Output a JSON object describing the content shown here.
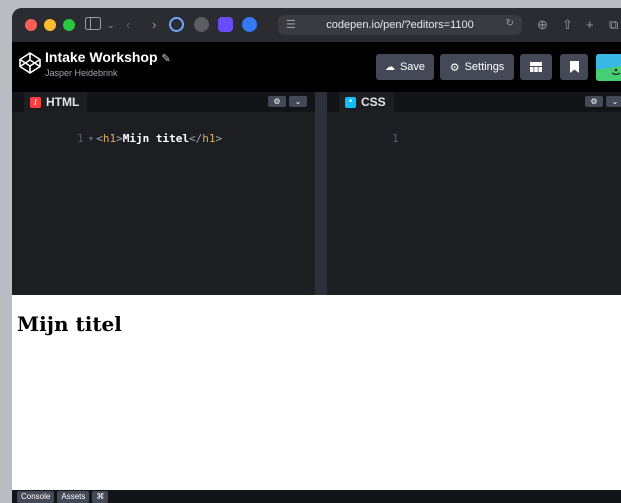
{
  "browser": {
    "url": "codepen.io/pen/?editors=1100",
    "traffic_colors": [
      "#ff5f57",
      "#febc2e",
      "#28c840"
    ],
    "icons": [
      "sidebar-icon",
      "chevron-down-icon",
      "back-icon",
      "forward-icon",
      "extension-icon",
      "extension-icon",
      "extension-icon",
      "extension-icon",
      "download-icon",
      "share-icon",
      "new-tab-icon",
      "tabs-icon"
    ]
  },
  "pen": {
    "title": "Intake Workshop",
    "author": "Jasper Heidebrink"
  },
  "header": {
    "save_label": "Save",
    "settings_label": "Settings"
  },
  "editors": {
    "html": {
      "label": "HTML",
      "badge_color": "#ff3c41",
      "line_number": "1",
      "code": {
        "open_bracket": "<",
        "open_tag": "h1",
        "close_bracket": ">",
        "text": "Mijn titel",
        "end_open": "</",
        "end_tag": "h1",
        "end_close": ">"
      }
    },
    "css": {
      "label": "CSS",
      "badge_color": "#0ebeff",
      "line_number": "1"
    }
  },
  "preview": {
    "heading": "Mijn titel"
  },
  "bottom_bar": {
    "console_label": "Console",
    "assets_label": "Assets",
    "shortcuts_label": "⌘"
  },
  "colors": {
    "codepen_header": "#010101",
    "button_bg": "#444857",
    "tag_name": "#e0ad5f"
  }
}
